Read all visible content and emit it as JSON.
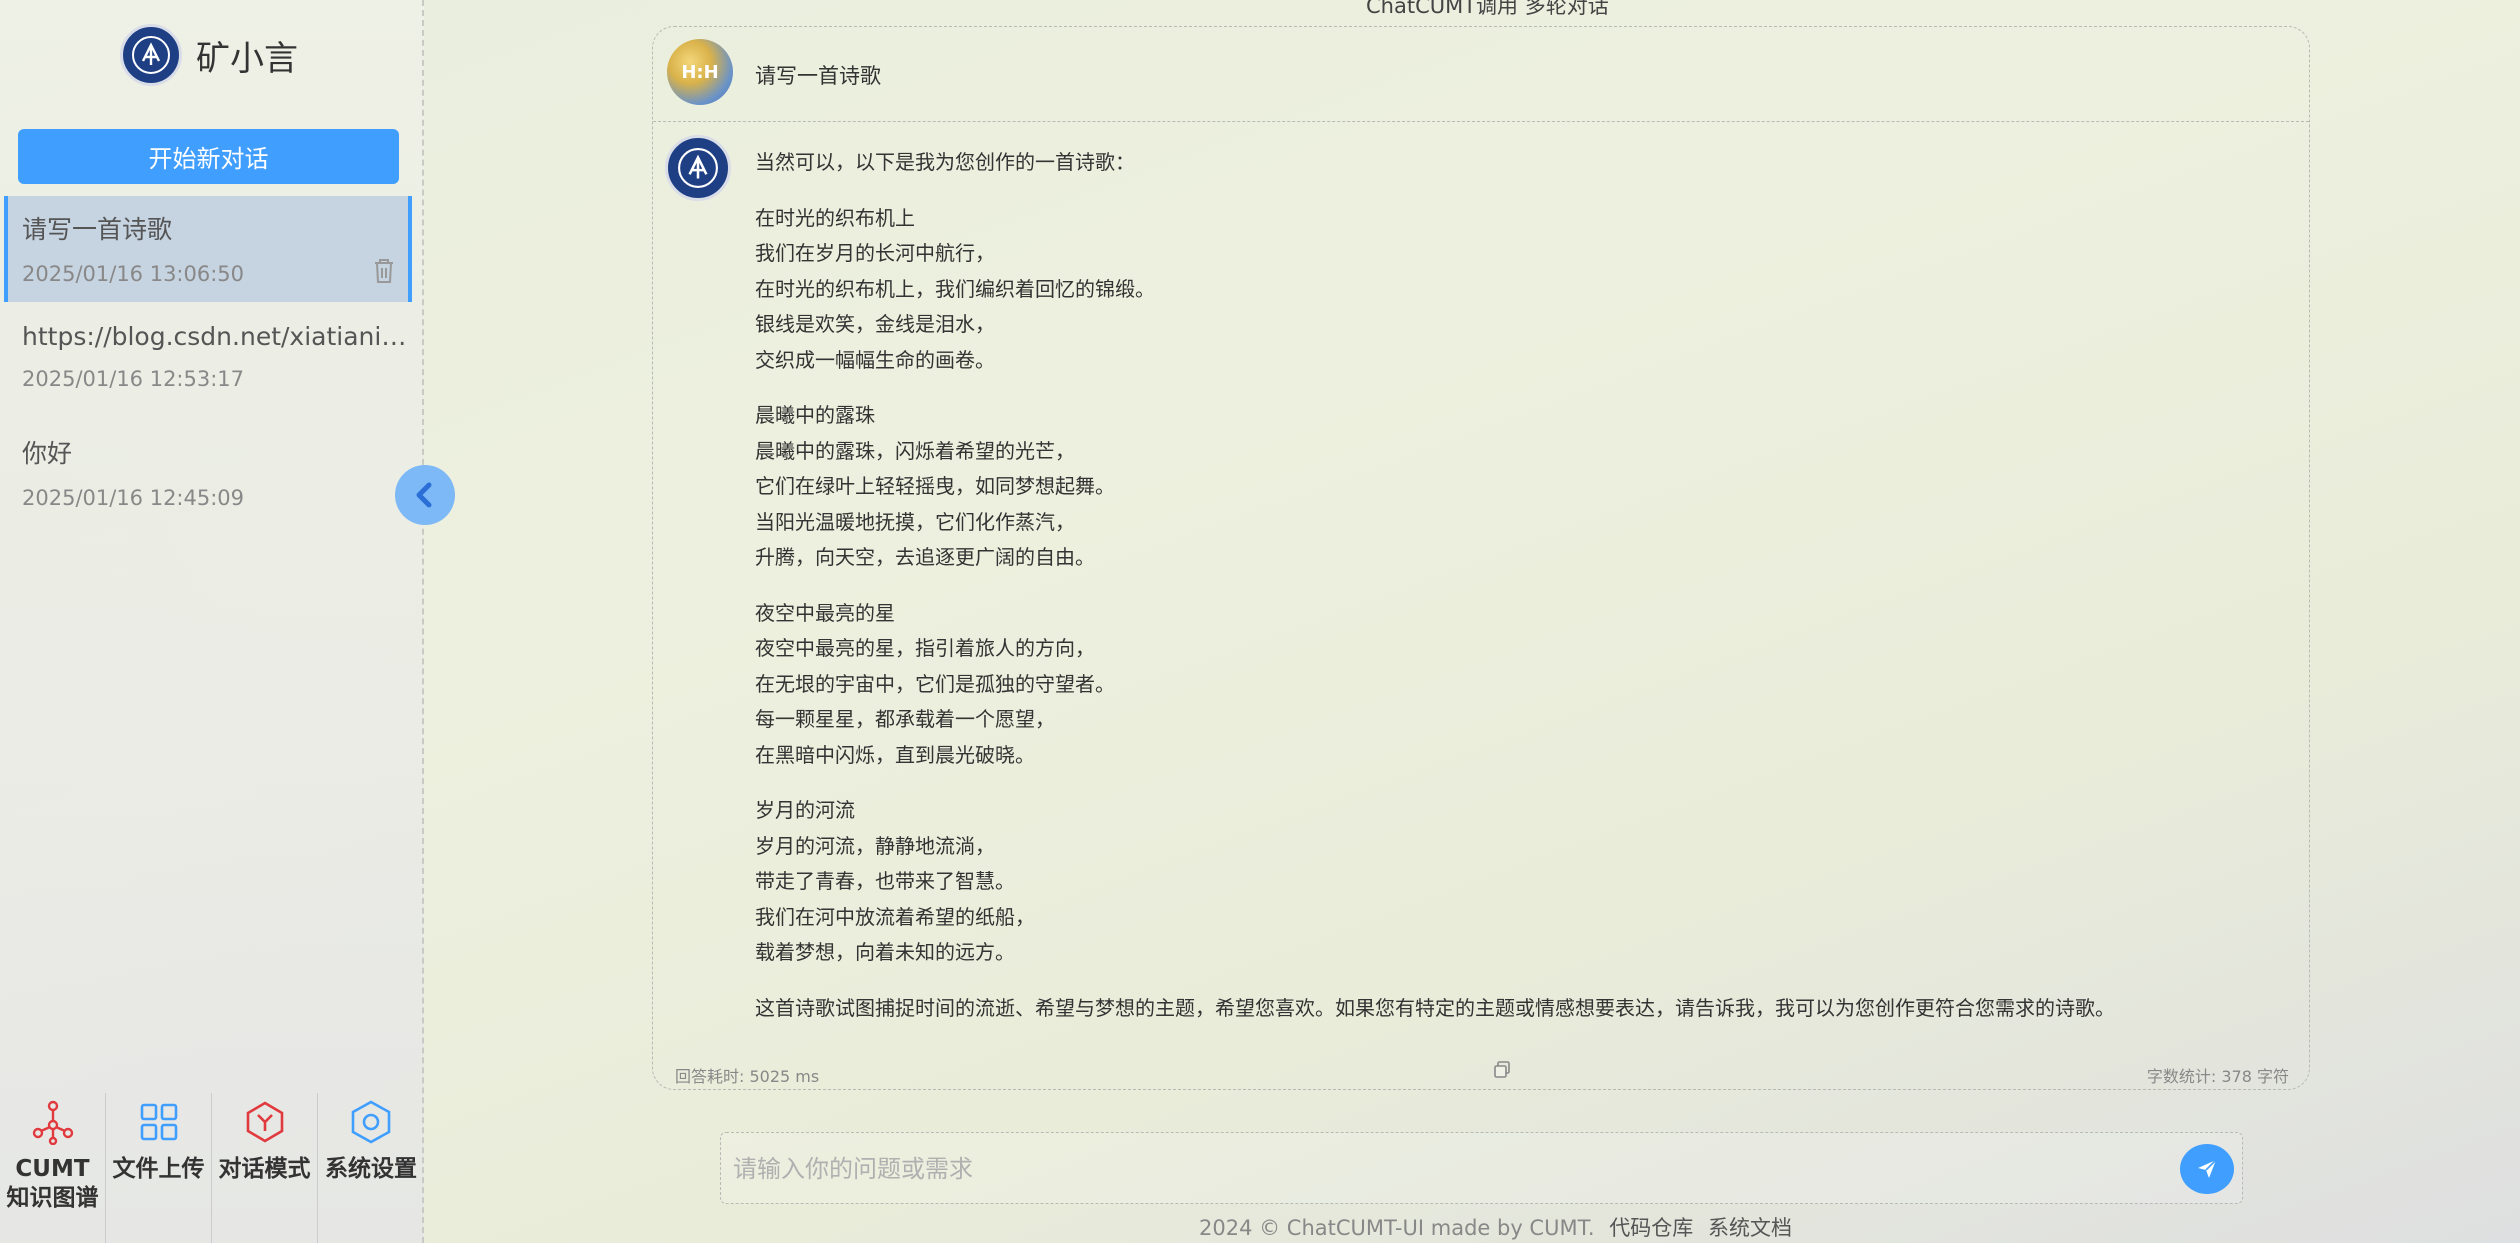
{
  "sidebar": {
    "brand": "矿小言",
    "new_chat": "开始新对话",
    "chats": [
      {
        "title": "请写一首诗歌",
        "date": "2025/01/16 13:06:50"
      },
      {
        "title": "https://blog.csdn.net/xiatianit/article/details/",
        "date": "2025/01/16 12:53:17"
      },
      {
        "title": "你好",
        "date": "2025/01/16 12:45:09"
      }
    ],
    "tools": [
      {
        "label_line1": "CUMT",
        "label_line2": "知识图谱",
        "icon": "graph-icon"
      },
      {
        "label_line1": "文件上传",
        "icon": "grid-icon"
      },
      {
        "label_line1": "对话模式",
        "icon": "cube-icon"
      },
      {
        "label_line1": "系统设置",
        "icon": "settings-icon"
      }
    ]
  },
  "main": {
    "title": "ChatCUMT调用 多轮对话",
    "question": "请写一首诗歌",
    "user_avatar_text": "H:H",
    "answer": {
      "intro": "当然可以，以下是我为您创作的一首诗歌：",
      "stanzas": [
        [
          "在时光的织布机上",
          "我们在岁月的长河中航行，",
          "在时光的织布机上，我们编织着回忆的锦缎。",
          "银线是欢笑，金线是泪水，",
          "交织成一幅幅生命的画卷。"
        ],
        [
          "晨曦中的露珠",
          "晨曦中的露珠，闪烁着希望的光芒，",
          "它们在绿叶上轻轻摇曳，如同梦想起舞。",
          "当阳光温暖地抚摸，它们化作蒸汽，",
          "升腾，向天空，去追逐更广阔的自由。"
        ],
        [
          "夜空中最亮的星",
          "夜空中最亮的星，指引着旅人的方向，",
          "在无垠的宇宙中，它们是孤独的守望者。",
          "每一颗星星，都承载着一个愿望，",
          "在黑暗中闪烁，直到晨光破晓。"
        ],
        [
          "岁月的河流",
          "岁月的河流，静静地流淌，",
          "带走了青春，也带来了智慧。",
          "我们在河中放流着希望的纸船，",
          "载着梦想，向着未知的远方。"
        ]
      ],
      "closing": "这首诗歌试图捕捉时间的流逝、希望与梦想的主题，希望您喜欢。如果您有特定的主题或情感想要表达，请告诉我，我可以为您创作更符合您需求的诗歌。"
    },
    "answer_time": "回答耗时: 5025 ms",
    "word_count": "字数统计: 378 字符",
    "input_placeholder": "请输入你的问题或需求",
    "footer": {
      "text": "2024 © ChatCUMT-UI made by CUMT.",
      "link_repo": "代码仓库",
      "link_docs": "系统文档"
    }
  },
  "colors": {
    "accent": "#409eff",
    "danger": "#e0393e",
    "active_item": "#c6d3e0"
  }
}
